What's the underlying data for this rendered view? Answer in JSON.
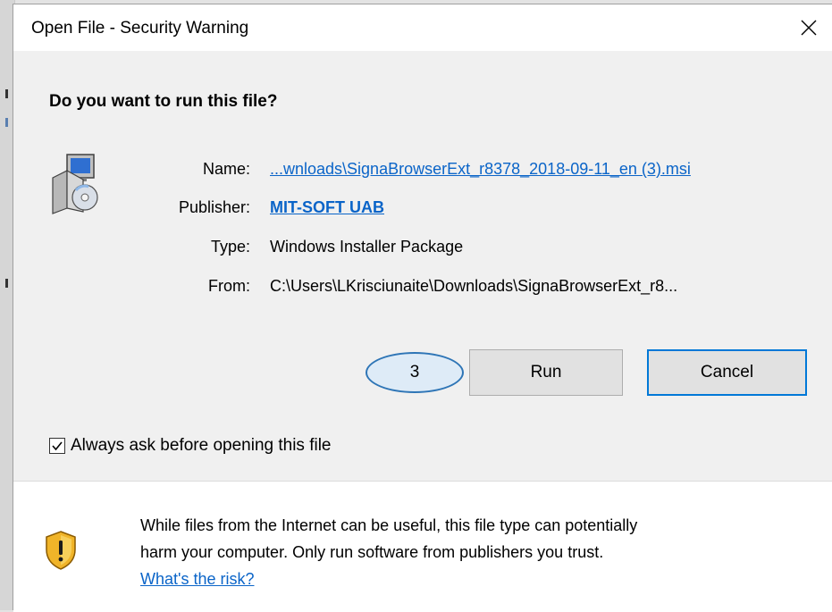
{
  "dialog": {
    "title": "Open File - Security Warning",
    "question": "Do you want to run this file?"
  },
  "file": {
    "name_label": "Name:",
    "name_value": "...wnloads\\SignaBrowserExt_r8378_2018-09-11_en (3).msi",
    "publisher_label": "Publisher:",
    "publisher_value": "MIT-SOFT UAB",
    "type_label": "Type:",
    "type_value": "Windows Installer Package",
    "from_label": "From:",
    "from_value": "C:\\Users\\LKrisciunaite\\Downloads\\SignaBrowserExt_r8..."
  },
  "annotation": {
    "step": "3",
    "color": "#2e75b6"
  },
  "buttons": {
    "run": "Run",
    "cancel": "Cancel"
  },
  "option": {
    "always_ask_label": "Always ask before opening this file",
    "always_ask_checked": true
  },
  "warning": {
    "line1": "While files from the Internet can be useful, this file type can potentially",
    "line2": "harm your computer. Only run software from publishers you trust.",
    "link": "What's the risk?"
  },
  "icons": {
    "close": "close-icon",
    "package": "installer-package-icon",
    "shield": "shield-warning-icon",
    "check": "checkmark-icon"
  },
  "colors": {
    "link": "#0a64c8",
    "default_button_border": "#0078d7"
  }
}
